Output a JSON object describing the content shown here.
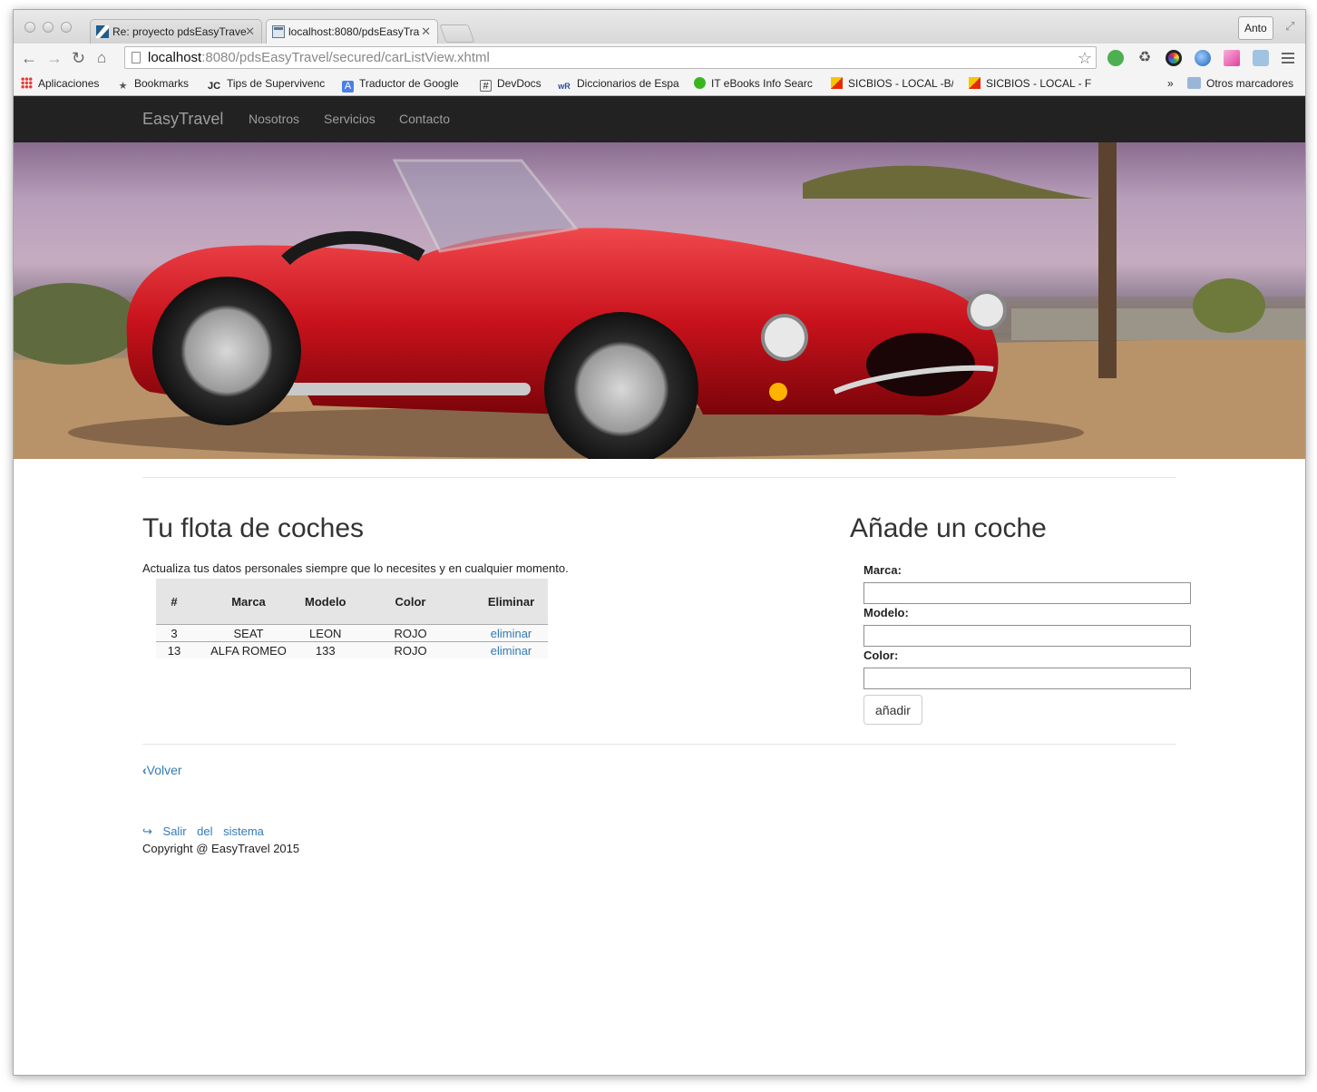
{
  "browser": {
    "tabs": [
      {
        "title": "Re: proyecto pdsEasyTrave",
        "active": false
      },
      {
        "title": "localhost:8080/pdsEasyTra",
        "active": true
      }
    ],
    "profile_name": "Anto",
    "url_host": "localhost",
    "url_rest": ":8080/pdsEasyTravel/secured/carListView.xhtml",
    "extension_icons": [
      "hangouts-icon",
      "recycle-icon",
      "color-wheel-icon",
      "globe-icon",
      "gradient-icon",
      "camera-icon"
    ],
    "bookmarks": [
      {
        "label": "Aplicaciones",
        "icon": "apps-grid-icon"
      },
      {
        "label": "Bookmarks",
        "icon": "star-icon"
      },
      {
        "label": "Tips de Supervivenc",
        "icon": "jc-icon"
      },
      {
        "label": "Traductor de Google",
        "icon": "translate-icon"
      },
      {
        "label": "DevDocs",
        "icon": "hash-icon"
      },
      {
        "label": "Diccionarios de Espa",
        "icon": "wr-icon"
      },
      {
        "label": "IT eBooks Info Searc",
        "icon": "green-ball-icon"
      },
      {
        "label": "SICBIOS - LOCAL -B/",
        "icon": "sicbios-icon"
      },
      {
        "label": "SICBIOS - LOCAL - F",
        "icon": "sicbios-icon"
      }
    ],
    "bookmarks_overflow": "»",
    "other_bookmarks": "Otros marcadores"
  },
  "navbar": {
    "brand": "EasyTravel",
    "links": [
      "Nosotros",
      "Servicios",
      "Contacto"
    ]
  },
  "fleet": {
    "title": "Tu flota de coches",
    "description": "Actualiza tus datos personales siempre que lo necesites y en cualquier momento.",
    "columns": [
      "#",
      "Marca",
      "Modelo",
      "Color",
      "Eliminar"
    ],
    "rows": [
      {
        "id": "3",
        "marca": "SEAT",
        "modelo": "LEON",
        "color": "ROJO",
        "action": "eliminar"
      },
      {
        "id": "13",
        "marca": "ALFA ROMEO",
        "modelo": "133",
        "color": "ROJO",
        "action": "eliminar"
      }
    ]
  },
  "add_car": {
    "title": "Añade un coche",
    "fields": [
      {
        "label": "Marca:",
        "value": ""
      },
      {
        "label": "Modelo:",
        "value": ""
      },
      {
        "label": "Color:",
        "value": ""
      }
    ],
    "submit_label": "añadir"
  },
  "footer": {
    "back_label": "Volver",
    "logout_label": "Salir del sistema",
    "copyright": "Copyright @ EasyTravel 2015"
  }
}
